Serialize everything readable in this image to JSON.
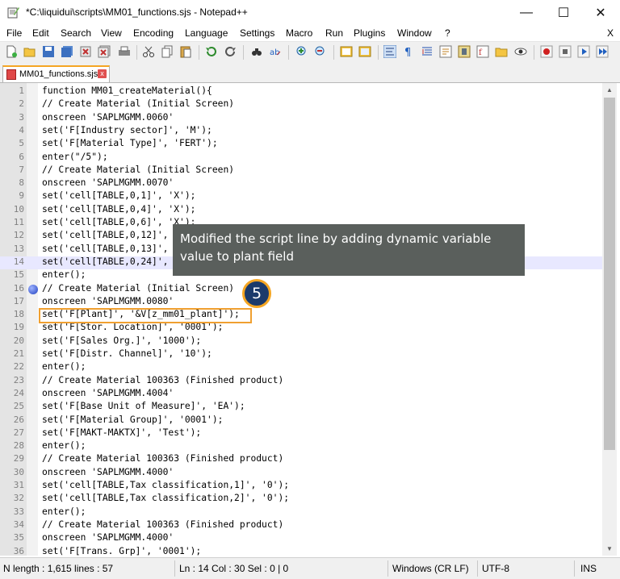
{
  "window": {
    "title": "*C:\\liquidui\\scripts\\MM01_functions.sjs - Notepad++",
    "minimize": "—",
    "maximize": "☐",
    "close": "✕"
  },
  "menu": {
    "items": [
      "File",
      "Edit",
      "Search",
      "View",
      "Encoding",
      "Language",
      "Settings",
      "Macro",
      "Run",
      "Plugins",
      "Window",
      "?"
    ],
    "close": "X"
  },
  "tab": {
    "label": "MM01_functions.sjs",
    "close": "x"
  },
  "editor": {
    "current_line": 14,
    "bookmark_line": 16,
    "lines": [
      "function MM01_createMaterial(){",
      "// Create Material (Initial Screen)",
      "onscreen 'SAPLMGMM.0060'",
      "set('F[Industry sector]', 'M');",
      "set('F[Material Type]', 'FERT');",
      "enter(\"/5\");",
      "// Create Material (Initial Screen)",
      "onscreen 'SAPLMGMM.0070'",
      "set('cell[TABLE,0,1]', 'X');",
      "set('cell[TABLE,0,4]', 'X');",
      "set('cell[TABLE,0,6]', 'X');",
      "set('cell[TABLE,0,12]', 'X');",
      "set('cell[TABLE,0,13]', 'X');",
      "set('cell[TABLE,0,24]', 'X');",
      "enter();",
      "// Create Material (Initial Screen)",
      "onscreen 'SAPLMGMM.0080'",
      "set('F[Plant]', '&V[z_mm01_plant]');",
      "set('F[Stor. Location]', '0001');",
      "set('F[Sales Org.]', '1000');",
      "set('F[Distr. Channel]', '10');",
      "enter();",
      "// Create Material 100363 (Finished product)",
      "onscreen 'SAPLMGMM.4004'",
      "set('F[Base Unit of Measure]', 'EA');",
      "set('F[Material Group]', '0001');",
      "set('F[MAKT-MAKTX]', 'Test');",
      "enter();",
      "// Create Material 100363 (Finished product)",
      "onscreen 'SAPLMGMM.4000'",
      "set('cell[TABLE,Tax classification,1]', '0');",
      "set('cell[TABLE,Tax classification,2]', '0');",
      "enter();",
      "// Create Material 100363 (Finished product)",
      "onscreen 'SAPLMGMM.4000'",
      "set('F[Trans. Grp]', '0001');"
    ]
  },
  "callout": {
    "text": "Modified the script line by adding dynamic variable value to plant field",
    "step": "5"
  },
  "status": {
    "length": "N  length : 1,615    lines : 57",
    "position": "Ln : 14    Col : 30    Sel : 0 | 0",
    "eol": "Windows (CR LF)",
    "encoding": "UTF-8",
    "mode": "INS"
  },
  "colors": {
    "accent": "#f5a623",
    "badge": "#1b3a6b",
    "current_line": "#e8e8ff"
  }
}
